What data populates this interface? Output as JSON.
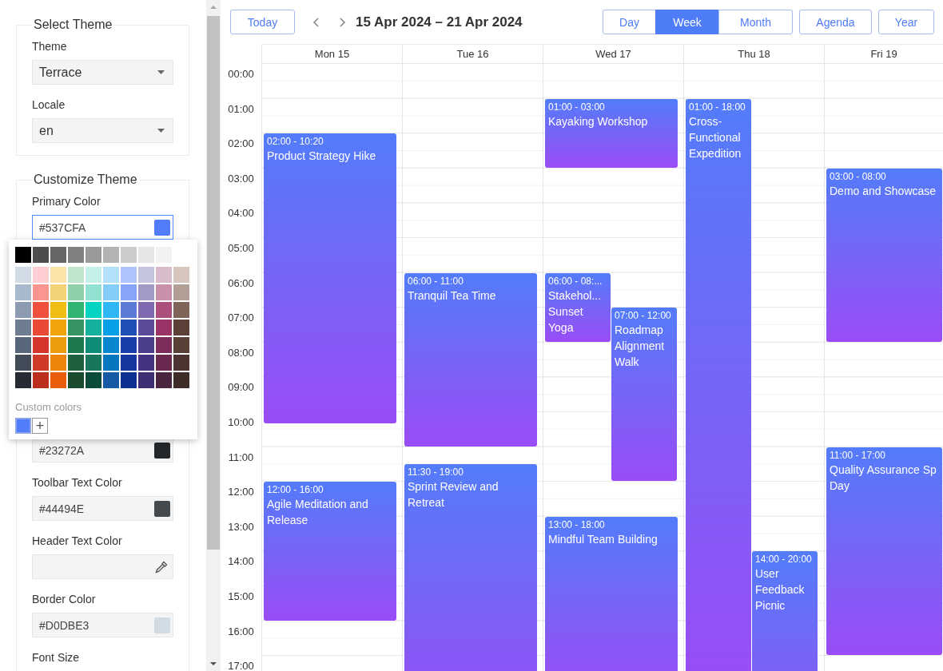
{
  "sections": [
    {
      "legend": "Select Theme",
      "fields": [
        {
          "kind": "select",
          "label": "Theme",
          "value": "Terrace"
        },
        {
          "kind": "select",
          "label": "Locale",
          "value": "en"
        }
      ]
    },
    {
      "legend": "Customize Theme",
      "fields": [
        {
          "kind": "color",
          "label": "Primary Color",
          "value": "#537CFA",
          "color": "#537cfa",
          "focused": true
        },
        {
          "kind": "color",
          "value": "#23272A",
          "color": "#23272a",
          "focused": false
        },
        {
          "kind": "color",
          "label": "Toolbar Text Color",
          "value": "#44494E",
          "color": "#44494e",
          "focused": false
        },
        {
          "kind": "color",
          "label": "Header Text Color",
          "focused": false
        },
        {
          "kind": "color",
          "label": "Border Color",
          "value": "#D0DBE3",
          "color": "#d0dbe3",
          "focused": false
        },
        {
          "kind": "label",
          "label": "Font Size"
        }
      ]
    }
  ],
  "palette": [
    [
      {
        "color": "#000000"
      },
      {
        "color": "#4d4d4d"
      },
      {
        "color": "#666666"
      },
      {
        "color": "#808080"
      },
      {
        "color": "#999999"
      },
      {
        "color": "#b3b3b3"
      },
      {
        "color": "#cccccc"
      },
      {
        "color": "#e6e6e6"
      },
      {
        "color": "#f2f2f2"
      }
    ],
    [
      {
        "color": "#d1dbe5"
      },
      {
        "color": "#ffcdd2"
      },
      {
        "color": "#fbe3a9"
      },
      {
        "color": "#bfe6cd"
      },
      {
        "color": "#c4f0ea"
      },
      {
        "color": "#b3e0fa"
      },
      {
        "color": "#b1c3fb"
      },
      {
        "color": "#c5c5e0"
      },
      {
        "color": "#d9bccb"
      },
      {
        "color": "#d7c6bd"
      }
    ],
    [
      {
        "color": "#a8b8cd"
      },
      {
        "color": "#fa9590"
      },
      {
        "color": "#f4d378"
      },
      {
        "color": "#8fcfa8"
      },
      {
        "color": "#92e2d3"
      },
      {
        "color": "#83cdf6"
      },
      {
        "color": "#86a4f8"
      },
      {
        "color": "#a09ac7"
      },
      {
        "color": "#c990ab"
      },
      {
        "color": "#b19f95"
      }
    ],
    [
      {
        "color": "#8c9bb0"
      },
      {
        "color": "#f0513f"
      },
      {
        "color": "#efbd13"
      },
      {
        "color": "#31b373"
      },
      {
        "color": "#05d3c2"
      },
      {
        "color": "#2fb7f5"
      },
      {
        "color": "#5b7bd6"
      },
      {
        "color": "#7f6ab1"
      },
      {
        "color": "#ac4f7d"
      },
      {
        "color": "#7e6459"
      }
    ],
    [
      {
        "color": "#6f7d90"
      },
      {
        "color": "#ea4a35"
      },
      {
        "color": "#f0a30b"
      },
      {
        "color": "#369363"
      },
      {
        "color": "#14b29d"
      },
      {
        "color": "#07a0e6"
      },
      {
        "color": "#1f4fb4"
      },
      {
        "color": "#5b4b9a"
      },
      {
        "color": "#9a3366"
      },
      {
        "color": "#5d4037"
      }
    ],
    [
      {
        "color": "#58677a"
      },
      {
        "color": "#d6352b"
      },
      {
        "color": "#eb9b0e"
      },
      {
        "color": "#1c7a4e"
      },
      {
        "color": "#0f8c76"
      },
      {
        "color": "#0986d0"
      },
      {
        "color": "#1a3ea8"
      },
      {
        "color": "#4c3e8a"
      },
      {
        "color": "#7d2d5a"
      },
      {
        "color": "#574137"
      }
    ],
    [
      {
        "color": "#424c58"
      },
      {
        "color": "#d03a28"
      },
      {
        "color": "#ec830a"
      },
      {
        "color": "#1f613f"
      },
      {
        "color": "#17765b"
      },
      {
        "color": "#0677bf"
      },
      {
        "color": "#14379f"
      },
      {
        "color": "#443380"
      },
      {
        "color": "#6a2a4f"
      },
      {
        "color": "#4c3530"
      }
    ],
    [
      {
        "color": "#252a33"
      },
      {
        "color": "#bb2d1d"
      },
      {
        "color": "#e85e0b"
      },
      {
        "color": "#194a2e"
      },
      {
        "color": "#0a4b39"
      },
      {
        "color": "#1659a5"
      },
      {
        "color": "#0c3091"
      },
      {
        "color": "#3e2d73"
      },
      {
        "color": "#4b2540"
      },
      {
        "color": "#3e2c27"
      }
    ]
  ],
  "custom_colors": {
    "label": "Custom colors",
    "colors": [
      {
        "color": "#537cfa",
        "selected": true
      }
    ],
    "add": "+"
  },
  "toolbar": {
    "today": "Today",
    "title": "15 Apr 2024 – 21 Apr 2024",
    "views": [
      {
        "label": "Day",
        "selected": false,
        "kind": "segment"
      },
      {
        "label": "Week",
        "selected": true,
        "kind": "segment"
      },
      {
        "label": "Month",
        "selected": false,
        "kind": "segment"
      },
      {
        "label": "Agenda",
        "selected": false,
        "kind": "single"
      },
      {
        "label": "Year",
        "selected": false,
        "kind": "single"
      }
    ]
  },
  "hours": [
    "00:00",
    "01:00",
    "02:00",
    "03:00",
    "04:00",
    "05:00",
    "06:00",
    "07:00",
    "08:00",
    "09:00",
    "10:00",
    "11:00",
    "12:00",
    "13:00",
    "14:00",
    "15:00",
    "16:00",
    "17:00"
  ],
  "days": [
    {
      "label": "Mon 15",
      "events": [
        {
          "time": "02:00 - 10:20",
          "title": "Product Strategy Hike"
        },
        {
          "time": "12:00 - 16:00",
          "title": "Agile Meditation and Release"
        }
      ]
    },
    {
      "label": "Tue 16",
      "events": [
        {
          "time": "06:00 - 11:00",
          "title": "Tranquil Tea Time"
        },
        {
          "time": "11:30 - 19:00",
          "title": "Sprint Review and Retreat"
        }
      ]
    },
    {
      "label": "Wed 17",
      "events": [
        {
          "time": "01:00 - 03:00",
          "title": "Kayaking Workshop"
        },
        {
          "time": "06:00 - 08:...",
          "title": "Stakehol... Sunset Yoga"
        },
        {
          "time": "07:00 - 12:00",
          "title": "Roadmap Alignment Walk"
        },
        {
          "time": "13:00 - 18:00",
          "title": "Mindful Team Building"
        }
      ]
    },
    {
      "label": "Thu 18",
      "events": [
        {
          "time": "01:00 - 18:00",
          "title": "Cross-Functional Expedition"
        },
        {
          "time": "14:00 - 20:00",
          "title": "User Feedback Picnic"
        }
      ]
    },
    {
      "label": "Fri 19",
      "events": [
        {
          "time": "03:00 - 08:00",
          "title": "Demo and Showcase"
        },
        {
          "time": "11:00 - 17:00",
          "title": "Quality Assurance Sp\nDay"
        }
      ]
    }
  ]
}
